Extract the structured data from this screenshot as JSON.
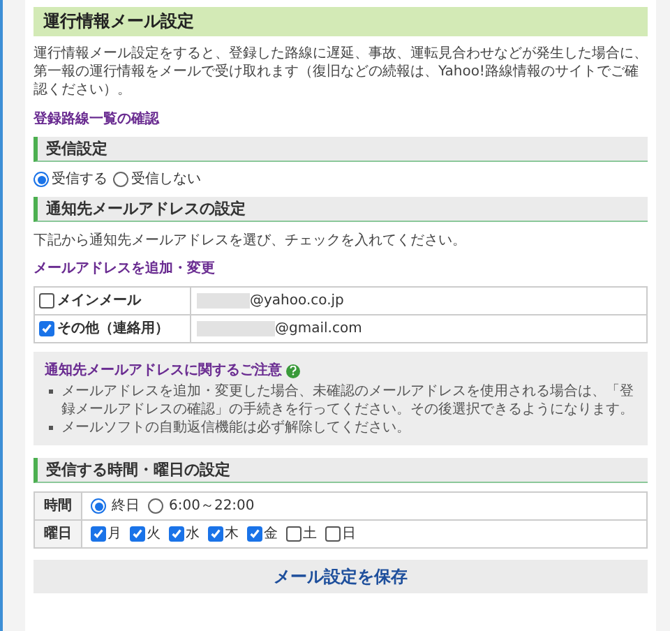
{
  "title": "運行情報メール設定",
  "description": "運行情報メール設定をすると、登録した路線に遅延、事故、運転見合わせなどが発生した場合に、第一報の運行情報をメールで受け取れます（復旧などの続報は、Yahoo!路線情報のサイトでご確認ください）。",
  "routes_link": "登録路線一覧の確認",
  "receive": {
    "heading": "受信設定",
    "options": [
      {
        "label": "受信する",
        "selected": true
      },
      {
        "label": "受信しない",
        "selected": false
      }
    ]
  },
  "address": {
    "heading": "通知先メールアドレスの設定",
    "instruction": "下記から通知先メールアドレスを選び、チェックを入れてください。",
    "link": "メールアドレスを追加・変更",
    "rows": [
      {
        "label": "メインメール",
        "checked": false,
        "domain": "@yahoo.co.jp"
      },
      {
        "label": "その他（連絡用）",
        "checked": true,
        "domain": "@gmail.com"
      }
    ]
  },
  "notice": {
    "title": "通知先メールアドレスに関するご注意",
    "items": [
      "メールアドレスを追加・変更した場合、未確認のメールアドレスを使用される場合は、「登録メールアドレスの確認」の手続きを行ってください。その後選択できるようになります。",
      "メールソフトの自動返信機能は必ず解除してください。"
    ]
  },
  "schedule": {
    "heading": "受信する時間・曜日の設定",
    "time_label": "時間",
    "time_options": [
      {
        "label": "終日",
        "selected": true
      },
      {
        "label": "6:00～22:00",
        "selected": false
      }
    ],
    "day_label": "曜日",
    "days": [
      {
        "label": "月",
        "checked": true
      },
      {
        "label": "火",
        "checked": true
      },
      {
        "label": "水",
        "checked": true
      },
      {
        "label": "木",
        "checked": true
      },
      {
        "label": "金",
        "checked": true
      },
      {
        "label": "土",
        "checked": false
      },
      {
        "label": "日",
        "checked": false
      }
    ]
  },
  "save_button": "メール設定を保存"
}
